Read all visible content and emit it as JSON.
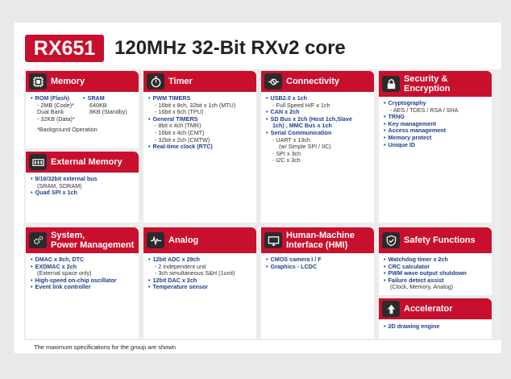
{
  "header": {
    "chip": "RX651",
    "title": "120MHz 32-Bit RXv2 core"
  },
  "colors": {
    "accent": "#c8102e",
    "link": "#1f3f8f",
    "icon_bg": "#2b2b2b"
  },
  "memory": {
    "title": "Memory",
    "icon": "memory-chip-icon",
    "rom": "ROM (Flash)",
    "rom_l1": "- 2MB (Code)*",
    "rom_l2": "Dual Bank",
    "rom_l3": "- 32KB (Data)*",
    "sram": "SRAM",
    "sram_l1": "640KB",
    "sram_l2": "8KB (Standby)",
    "note": "*Background Operation"
  },
  "timer": {
    "title": "Timer",
    "icon": "stopwatch-icon",
    "items": [
      {
        "text": "PWM TIMERS",
        "kind": "head"
      },
      {
        "text": "- 16bit x 8ch, 32bit x 1ch (MTU)",
        "kind": "sub"
      },
      {
        "text": "- 16bit x 6ch (TPU)",
        "kind": "sub"
      },
      {
        "text": "General TIMERS",
        "kind": "head"
      },
      {
        "text": "- 8bit x 4ch (TMR)",
        "kind": "sub"
      },
      {
        "text": "- 16bit x 4ch (CMT)",
        "kind": "sub"
      },
      {
        "text": "- 32bit x 2ch (CMTW)",
        "kind": "sub"
      },
      {
        "text": "Real-time clock (RTC)",
        "kind": "head"
      }
    ]
  },
  "connectivity": {
    "title": "Connectivity",
    "icon": "plug-icon",
    "items": [
      {
        "text": "USB2.0 x 1ch",
        "kind": "head"
      },
      {
        "text": "- Full Speed H/F x 1ch",
        "kind": "sub"
      },
      {
        "text": "CAN x 2ch",
        "kind": "head"
      },
      {
        "text": "SD Bus x 2ch (Host 1ch,Slave",
        "kind": "head"
      },
      {
        "text": "1ch) , MMC Bus x 1ch",
        "kind": "cont"
      },
      {
        "text": "Serial Communication",
        "kind": "head"
      },
      {
        "text": "- UART x 13ch",
        "kind": "sub"
      },
      {
        "text": "(w/ Simple SPI / IIC)",
        "kind": "sub2"
      },
      {
        "text": "- SPI x 3ch",
        "kind": "sub"
      },
      {
        "text": "- I2C x 3ch",
        "kind": "sub"
      }
    ]
  },
  "security": {
    "title_l1": "Security &",
    "title_l2": "Encryption",
    "icon": "lock-icon",
    "items": [
      {
        "text": "Cryptography",
        "kind": "head"
      },
      {
        "text": "- AES / TDES / RSA / SHA",
        "kind": "sub"
      },
      {
        "text": "TRNG",
        "kind": "head"
      },
      {
        "text": "Key management",
        "kind": "head"
      },
      {
        "text": "Access management",
        "kind": "head"
      },
      {
        "text": "Memory protect",
        "kind": "head"
      },
      {
        "text": "Unique ID",
        "kind": "head"
      }
    ]
  },
  "external_memory": {
    "title": "External Memory",
    "icon": "memory-module-icon",
    "items": [
      {
        "text": "8/16/32bit external bus",
        "kind": "head"
      },
      {
        "text": "(SRAM, SDRAM)",
        "kind": "sub"
      },
      {
        "text": "Quad SPI x 1ch",
        "kind": "head"
      }
    ]
  },
  "system": {
    "title_l1": "System,",
    "title_l2": "Power Management",
    "icon": "gears-icon",
    "items": [
      {
        "text": "DMAC x 8ch, DTC",
        "kind": "head"
      },
      {
        "text": "EXDMAC x 2ch",
        "kind": "head"
      },
      {
        "text": "(External space only)",
        "kind": "sub"
      },
      {
        "text": "High-speed on-chip oscillator",
        "kind": "head"
      },
      {
        "text": "Event link controller",
        "kind": "head"
      }
    ]
  },
  "analog": {
    "title": "Analog",
    "icon": "waveform-icon",
    "items": [
      {
        "text": "12bit  ADC x 29ch",
        "kind": "head"
      },
      {
        "text": "- 2 independent unit",
        "kind": "sub"
      },
      {
        "text": "- 3ch simultaneous S&H (1unit)",
        "kind": "sub"
      },
      {
        "text": "12bit DAC x 2ch",
        "kind": "head"
      },
      {
        "text": "Temperature sensor",
        "kind": "head"
      }
    ]
  },
  "hmi": {
    "title_l1": "Human-Machine",
    "title_l2": "Interface (HMI)",
    "icon": "display-icon",
    "items": [
      {
        "text": "CMOS camera I / F",
        "kind": "head"
      },
      {
        "text": "Graphics - LCDC",
        "kind": "head"
      }
    ]
  },
  "safety": {
    "title": "Safety Functions",
    "icon": "shield-check-icon",
    "items": [
      {
        "text": "Watchdog timer x 2ch",
        "kind": "head"
      },
      {
        "text": "CRC calculator",
        "kind": "head"
      },
      {
        "text": "PWM wave output shutdown",
        "kind": "head"
      },
      {
        "text": "Failure detect assist",
        "kind": "head"
      },
      {
        "text": "(Clock, Memory, Analog)",
        "kind": "sub"
      }
    ]
  },
  "accelerator": {
    "title": "Accelerator",
    "icon": "arrow-up-icon",
    "items": [
      {
        "text": "2D drawing engine",
        "kind": "head"
      }
    ]
  },
  "footnote": "The maximum specifications for the group are shown"
}
